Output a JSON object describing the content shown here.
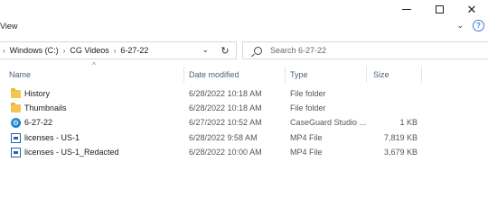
{
  "window": {
    "minimize_glyph": "—",
    "maximize_glyph": "☐",
    "close_glyph": "✕"
  },
  "ribbon": {
    "view_label": "View",
    "expand_glyph": "⌄",
    "help_glyph": "?"
  },
  "address": {
    "segments": [
      "Windows (C:)",
      "CG Videos",
      "6-27-22"
    ],
    "separator": "›",
    "lead_separator": "›",
    "dropdown_glyph": "⌄",
    "refresh_glyph": "↻"
  },
  "search": {
    "placeholder": "Search 6-27-22"
  },
  "columns": {
    "name": "Name",
    "date": "Date modified",
    "type": "Type",
    "size": "Size",
    "sort_glyph": "^"
  },
  "files": [
    {
      "name": "History",
      "date": "6/28/2022 10:18 AM",
      "type": "File folder",
      "size": "",
      "icon": "folder-icon"
    },
    {
      "name": "Thumbnails",
      "date": "6/28/2022 10:18 AM",
      "type": "File folder",
      "size": "",
      "icon": "folder-icon"
    },
    {
      "name": "6-27-22",
      "date": "6/27/2022 10:52 AM",
      "type": "CaseGuard Studio ...",
      "size": "1 KB",
      "icon": "caseguard-app-icon"
    },
    {
      "name": "licenses - US-1",
      "date": "6/28/2022 9:58 AM",
      "type": "MP4 File",
      "size": "7,819 KB",
      "icon": "video-file-icon"
    },
    {
      "name": "licenses - US-1_Redacted",
      "date": "6/28/2022 10:00 AM",
      "type": "MP4 File",
      "size": "3,679 KB",
      "icon": "video-file-icon"
    }
  ]
}
